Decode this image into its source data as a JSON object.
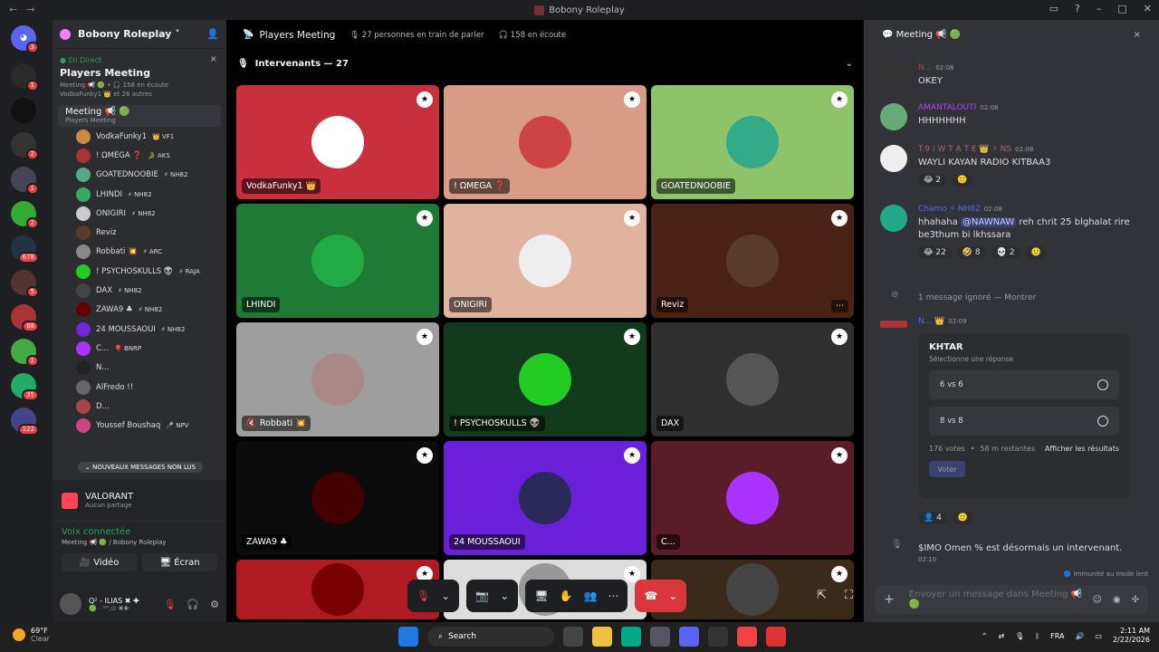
{
  "window": {
    "title": "Bobony Roleplay",
    "back": "←",
    "fwd": "→"
  },
  "server": {
    "name": "Bobony Roleplay ˅",
    "add_icon": "add-person-icon"
  },
  "event": {
    "live": "● En Direct",
    "title": "Players Meeting",
    "line1": "Meeting 📢 🟢 • 🎧 158 en écoute",
    "line2": "VodkaFunky1 👑 et 26 autres",
    "close": "×"
  },
  "channel": {
    "name": "Meeting 📢 🟢",
    "sub": "Players Meeting"
  },
  "members": [
    {
      "name": "VodkaFunky1",
      "tag": "👑 VF1",
      "color": "#c84"
    },
    {
      "name": "! ΩMEGA ❓",
      "tag": "🐊 AKS",
      "color": "#a33"
    },
    {
      "name": "GOATEDNOOBIE",
      "tag": "⚡ NH82",
      "color": "#5a8"
    },
    {
      "name": "LHINDI",
      "tag": "⚡ NH82",
      "color": "#3a6"
    },
    {
      "name": "ONIGIRI",
      "tag": "⚡ NH82",
      "color": "#ccc"
    },
    {
      "name": "Reviz",
      "tag": "",
      "color": "#5a3a2a"
    },
    {
      "name": "Robbati 💥",
      "tag": "⚡ ARC",
      "color": "#888"
    },
    {
      "name": "! PSYCHOSKULLS 👽",
      "tag": "⚡ RAJA",
      "color": "#2c2"
    },
    {
      "name": "DAX",
      "tag": "⚡ NH82",
      "color": "#444"
    },
    {
      "name": "ZAWA9 ♣",
      "tag": "⚡ NH82",
      "color": "#600"
    },
    {
      "name": "24 MOUSSAOUI",
      "tag": "⚡ NH82",
      "color": "#6a2ad8"
    },
    {
      "name": "C...",
      "tag": "🎈 BNRP",
      "color": "#a3f"
    },
    {
      "name": "N...",
      "tag": "",
      "color": "#222"
    },
    {
      "name": "AlFredo !!",
      "tag": "",
      "color": "#666"
    },
    {
      "name": "D...",
      "tag": "",
      "color": "#a44"
    },
    {
      "name": "Youssef Boushaq",
      "tag": "🎤 NPV",
      "color": "#c48"
    }
  ],
  "new_messages": "⌄ NOUVEAUX MESSAGES NON LUS",
  "game": {
    "name": "VALORANT",
    "status": "Aucun partage"
  },
  "voice": {
    "title": "Voix connectée",
    "sub": "Meeting 📢 🟢 / Bobony Roleplay",
    "video": "🎥 Vidéo",
    "screen": "🖥 Écran"
  },
  "user": {
    "name": "Q² - ILIAS ✖ ✚",
    "status": "🟢 · ᴳᴼ,⊙ ✖✚"
  },
  "servers": [
    {
      "badge": "3",
      "color": "#5865f2"
    },
    {
      "badge": "1",
      "color": "#2a2a2a"
    },
    {
      "badge": "",
      "color": "#111"
    },
    {
      "badge": "2",
      "color": "#333"
    },
    {
      "badge": "1",
      "color": "#445"
    },
    {
      "badge": "2",
      "color": "#3a3"
    },
    {
      "badge": "678",
      "color": "#234"
    },
    {
      "badge": "5",
      "color": "#533"
    },
    {
      "badge": "68",
      "color": "#a33"
    },
    {
      "badge": "1",
      "color": "#4a4"
    },
    {
      "badge": "35",
      "color": "#2a6"
    },
    {
      "badge": "122",
      "color": "#448"
    }
  ],
  "stage": {
    "title": "Players Meeting",
    "speaking": "27 personnes en train de parler",
    "listening": "158 en écoute",
    "speakers": "Intervenants — 27"
  },
  "tiles": [
    {
      "name": "VodkaFunky1 👑",
      "bg": "#c9303e",
      "pic": "#fff"
    },
    {
      "name": "! ΩMEGA ❓",
      "bg": "#d89c86",
      "pic": "#c44"
    },
    {
      "name": "GOATEDNOOBIE",
      "bg": "#8fc36a",
      "pic": "#3a8"
    },
    {
      "name": "LHINDI",
      "bg": "#1f7a35",
      "pic": "#2a4"
    },
    {
      "name": "ONIGIRI",
      "bg": "#e0b39e",
      "pic": "#eee"
    },
    {
      "name": "Reviz",
      "bg": "#4a2316",
      "pic": "#5a3a2a"
    },
    {
      "name": "🔇 Robbati 💥",
      "bg": "#9e9e9e",
      "pic": "#a88"
    },
    {
      "name": "! PSYCHOSKULLS 👽",
      "bg": "#123a1c",
      "pic": "#2c2"
    },
    {
      "name": "DAX",
      "bg": "#2f2f2f",
      "pic": "#555"
    },
    {
      "name": "ZAWA9 ♣",
      "bg": "#0c0c0c",
      "pic": "#400"
    },
    {
      "name": "24 MOUSSAOUI",
      "bg": "#6a1fd8",
      "pic": "#2a2a5a"
    },
    {
      "name": "C...",
      "bg": "#5a1c28",
      "pic": "#a3f"
    },
    {
      "name": "",
      "bg": "#b01a22",
      "pic": "#700"
    },
    {
      "name": "",
      "bg": "#ddd",
      "pic": "#999"
    },
    {
      "name": "",
      "bg": "#3a2a1a",
      "pic": "#444"
    }
  ],
  "chat": {
    "title": "Meeting 📢 🟢",
    "close": "×",
    "input": "Envoyer un message dans Meeting 📢 🟢",
    "immunity": "🔵 Immunité au mode lent"
  },
  "messages": [
    {
      "author": "N...",
      "time": "02:08",
      "body": "OKEY",
      "color": "#a44",
      "av": "#333"
    },
    {
      "author": "AMANTALOUTI",
      "time": "02:08",
      "body": "HHHHHHH",
      "color": "#a4f",
      "av": "#6a7"
    },
    {
      "author": "T.9 I W T A T E 👑 ⚡ NS",
      "time": "02:08",
      "body": "WAYLI KAYAN RADIO KITBAA3",
      "color": "#a66",
      "av": "#eee",
      "reacts": [
        "😂 2",
        "🙂"
      ]
    },
    {
      "author": "Chamo ⚡ NH82",
      "time": "02:08",
      "body": "hhahaha @NAWNAW reh chrit 25 blghalat rire be3thum bi lkhssara",
      "color": "#5865f2",
      "av": "#2a8",
      "reacts": [
        "😂 22",
        "🤣 8",
        "💀 2",
        "🙂"
      ]
    }
  ],
  "ignored": "1 message ignoré — Montrer",
  "poll_author": {
    "name": "N... 👑",
    "time": "02:09"
  },
  "poll": {
    "question": "KHTAR",
    "hint": "Sélectionne une réponse",
    "options": [
      "6 vs 6",
      "8 vs 8"
    ],
    "votes": "176 votes",
    "remaining": "58 m restantes",
    "results": "Afficher les résultats",
    "vote": "Voter"
  },
  "poll_react": "👤 4",
  "system": {
    "text": "$IMO Omen % est désormais un intervenant.",
    "time": "02:10"
  },
  "taskbar": {
    "temp": "69°F",
    "weather": "Clear",
    "search": "Search",
    "lang": "FRA",
    "time": "2:11 AM",
    "date": "2/22/2026"
  }
}
